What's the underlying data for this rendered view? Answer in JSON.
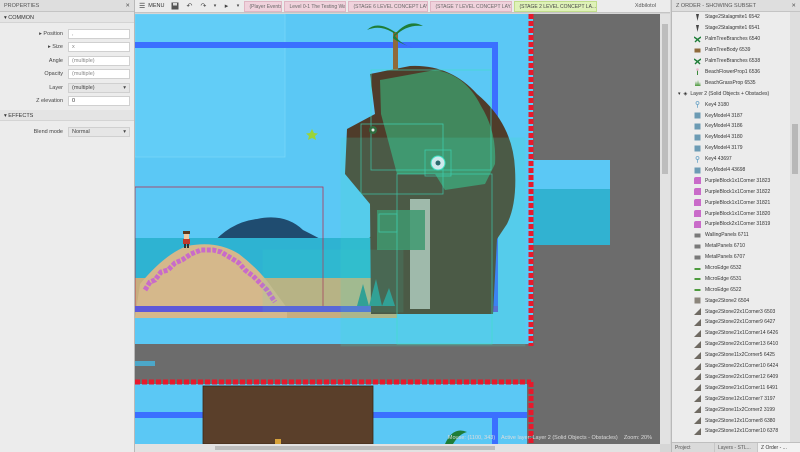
{
  "properties": {
    "title": "PROPERTIES",
    "common_label": "COMMON",
    "effects_label": "EFFECTS",
    "rows": [
      {
        "label": "Position",
        "value": ",",
        "expandable": true
      },
      {
        "label": "Size",
        "value": "x",
        "expandable": true
      },
      {
        "label": "Angle",
        "value": "(multiple)"
      },
      {
        "label": "Opacity",
        "value": "(multiple)"
      },
      {
        "label": "Layer",
        "value": "(multiple)",
        "dropdown": true
      },
      {
        "label": "Z elevation",
        "value": "0"
      }
    ],
    "blend_label": "Blend mode",
    "blend_value": "Normal"
  },
  "toolbar": {
    "menu_label": "MENU",
    "tabs": [
      {
        "label": "(Player Events)"
      },
      {
        "label": "Level 0-1 The Testing Ward"
      },
      {
        "label": "(STAGE 6 LEVEL CONCEPT LAY..."
      },
      {
        "label": "(STAGE 7 LEVEL CONCEPT LAY..."
      },
      {
        "label": "(STAGE 2 LEVEL CONCEPT LA..."
      }
    ],
    "user": "Xdbilotol"
  },
  "canvas": {
    "status_mouse": "Mouse: (1100, 343)",
    "status_layer": "Active layer: Layer 2 (Solid Objects - Obstacles)",
    "status_zoom": "Zoom: 20%"
  },
  "zorder": {
    "title": "Z ORDER - SHOWING SUBSET",
    "top_items": [
      {
        "label": "Stage2Stalagmite1 6542",
        "icon": "stalagmite-icon"
      },
      {
        "label": "Stage2Stalagmite1 6541",
        "icon": "stalagmite-icon"
      },
      {
        "label": "PalmTreeBranches 6540",
        "icon": "palm-branches-icon"
      },
      {
        "label": "PalmTreeBody 6539",
        "icon": "palm-body-icon"
      },
      {
        "label": "PalmTreeBranches 6538",
        "icon": "palm-branches-icon"
      },
      {
        "label": "BeachFlowerProp1 6536",
        "icon": "flower-icon"
      },
      {
        "label": "BeachGrassProp 6535",
        "icon": "grass-icon"
      }
    ],
    "layer_label": "Layer 2 (Solid Objects + Obstacles)",
    "layer_items": [
      {
        "label": "Key4 3180",
        "icon": "key-icon"
      },
      {
        "label": "KeyModel4 3187",
        "icon": "key-model-icon"
      },
      {
        "label": "KeyModel4 3186",
        "icon": "key-model-icon"
      },
      {
        "label": "KeyModel4 3180",
        "icon": "key-model-icon"
      },
      {
        "label": "KeyModel4 3179",
        "icon": "key-model-icon"
      },
      {
        "label": "Key4 43697",
        "icon": "key-icon"
      },
      {
        "label": "KeyModel4 43698",
        "icon": "key-model-icon"
      },
      {
        "label": "PurpleBlock1x1Corner 31823",
        "icon": "purple-block-icon"
      },
      {
        "label": "PurpleBlock1x1Corner 31822",
        "icon": "purple-block-icon"
      },
      {
        "label": "PurpleBlock1x1Corner 31821",
        "icon": "purple-block-icon"
      },
      {
        "label": "PurpleBlock1x1Corner 31820",
        "icon": "purple-block-icon"
      },
      {
        "label": "PurpleBlock2x1Corner 31819",
        "icon": "purple-block-icon"
      },
      {
        "label": "WallingPanels 6711",
        "icon": "panel-icon"
      },
      {
        "label": "MetalPanels 6710",
        "icon": "panel-icon"
      },
      {
        "label": "MetalPanels 6707",
        "icon": "panel-icon"
      },
      {
        "label": "MicroEdge 6532",
        "icon": "edge-icon"
      },
      {
        "label": "MicroEdge 6531",
        "icon": "edge-icon"
      },
      {
        "label": "MicroEdge 6522",
        "icon": "edge-icon"
      },
      {
        "label": "Stage2Stone2 6504",
        "icon": "stone-icon"
      },
      {
        "label": "Stage2Stone22x1Corner3 6503",
        "icon": "stone-slope-icon"
      },
      {
        "label": "Stage2Stone22x1Corner9 6427",
        "icon": "stone-slope-icon"
      },
      {
        "label": "Stage2Stone21x1Corner14 6426",
        "icon": "stone-slope-icon"
      },
      {
        "label": "Stage2Stone22x1Corner13 6410",
        "icon": "stone-slope-icon"
      },
      {
        "label": "Stage2Stone11x2Corner5 6425",
        "icon": "stone-slope-icon"
      },
      {
        "label": "Stage2Stone22x1Corner10 6424",
        "icon": "stone-slope-icon"
      },
      {
        "label": "Stage2Stone22x1Corner12 6409",
        "icon": "stone-slope-icon"
      },
      {
        "label": "Stage2Stone21x1Corner11 6491",
        "icon": "stone-slope-icon"
      },
      {
        "label": "Stage2Stone12x1Corner7 3197",
        "icon": "stone-slope-icon"
      },
      {
        "label": "Stage2Stone11x2Corner2 3199",
        "icon": "stone-slope-icon"
      },
      {
        "label": "Stage2Stone12x1Corner8 6380",
        "icon": "stone-slope-icon"
      },
      {
        "label": "Stage2Stone12x1Corner10 6378",
        "icon": "stone-slope-icon"
      }
    ],
    "tabs": [
      {
        "label": "Project"
      },
      {
        "label": "Layers - STL..."
      },
      {
        "label": "Z Order - ..."
      }
    ]
  },
  "colors": {
    "sky": "#5bc8f5",
    "sea": "#2fb3d3",
    "sand": "#d5b88b",
    "purple": "#c96bc9",
    "teal_selection": "#3de0c2",
    "red_border": "#e8192c",
    "blue_border": "#3b6fff"
  }
}
